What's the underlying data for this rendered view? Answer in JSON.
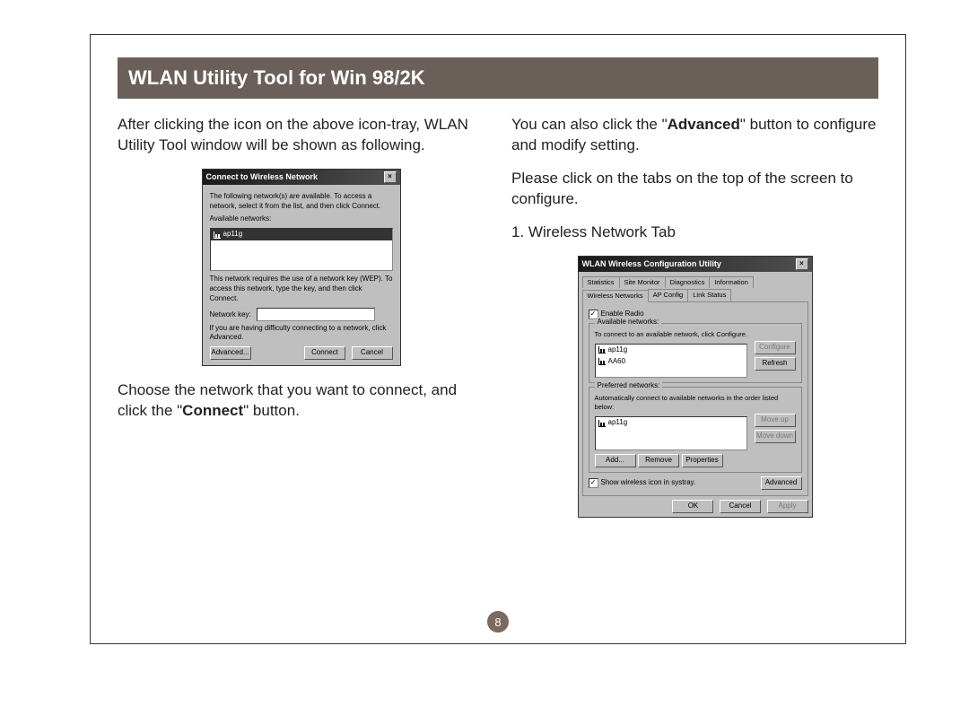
{
  "page_number": "8",
  "title": "WLAN Utility Tool for Win 98/2K",
  "left": {
    "p1": "After clicking the icon on the above icon-tray, WLAN Utility Tool window will be shown as following.",
    "p2a": "Choose the network that you want to connect, and click the \"",
    "p2b": "Connect",
    "p2c": "\" button."
  },
  "right": {
    "p1a": "You can also click the \"",
    "p1b": "Advanced",
    "p1c": "\" button to configure and modify setting.",
    "p2": "Please click on the tabs on the top of the screen to configure.",
    "h1": "1. Wireless Network Tab"
  },
  "ss1": {
    "title": "Connect to Wireless Network",
    "hint1": "The following network(s) are available. To access a network, select it from the list, and then click Connect.",
    "avail_label": "Available networks:",
    "item": "ap11g",
    "hint2": "This network requires the use of a network key (WEP). To access this network, type the key, and then click Connect.",
    "key_label": "Network key:",
    "hint3": "If you are having difficulty connecting to a network, click Advanced.",
    "btn_adv": "Advanced...",
    "btn_connect": "Connect",
    "btn_cancel": "Cancel"
  },
  "ss2": {
    "title": "WLAN Wireless Configuration Utility",
    "tabs_row1": [
      "Statistics",
      "Site Monitor",
      "Diagnostics",
      "Information"
    ],
    "tabs_row2": [
      "Wireless Networks",
      "AP Config",
      "Link Status"
    ],
    "enable_radio": "Enable Radio",
    "avail_label": "Available networks:",
    "avail_hint": "To connect to an available network, click Configure.",
    "avail_items": [
      "ap11g",
      "AA60"
    ],
    "btn_configure": "Configure",
    "btn_refresh": "Refresh",
    "pref_label": "Preferred networks:",
    "pref_hint": "Automatically connect to available networks in the order listed below:",
    "pref_items": [
      "ap11g"
    ],
    "btn_moveup": "Move up",
    "btn_movedown": "Move down",
    "btn_add": "Add...",
    "btn_remove": "Remove",
    "btn_props": "Properties",
    "show_tray": "Show wireless icon in systray.",
    "btn_advanced": "Advanced",
    "btn_ok": "OK",
    "btn_cancel": "Cancel",
    "btn_apply": "Apply"
  }
}
